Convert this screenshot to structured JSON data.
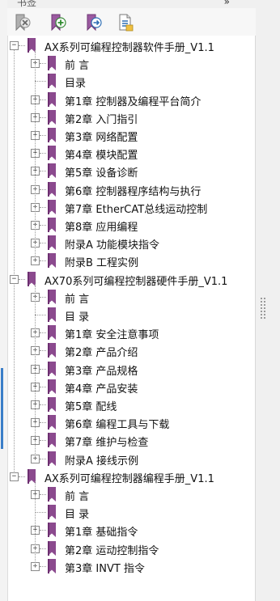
{
  "panel": {
    "title": "书签",
    "collapse_glyph": "»",
    "toolbar": [
      {
        "name": "delete-bookmark",
        "icon": "delete-bookmark-icon"
      },
      {
        "name": "add-bookmark",
        "icon": "add-bookmark-icon"
      },
      {
        "name": "move-bookmark",
        "icon": "move-bookmark-icon"
      },
      {
        "name": "bookmark-properties",
        "icon": "document-properties-icon"
      }
    ]
  },
  "colors": {
    "bookmark": "#8b4a8e",
    "accent": "#3a7ec8",
    "text": "#111111"
  },
  "manuals": [
    {
      "title": "AX系列可编程控制器软件手册_V1.1",
      "expanded": true,
      "chapters": [
        {
          "label": "前 言",
          "expandable": true
        },
        {
          "label": "目录",
          "expandable": false
        },
        {
          "label": "第1章 控制器及编程平台简介",
          "expandable": true
        },
        {
          "label": "第2章 入门指引",
          "expandable": true
        },
        {
          "label": "第3章 网络配置",
          "expandable": true
        },
        {
          "label": "第4章 模块配置",
          "expandable": true
        },
        {
          "label": "第5章 设备诊断",
          "expandable": true
        },
        {
          "label": "第6章 控制器程序结构与执行",
          "expandable": true
        },
        {
          "label": "第7章 EtherCAT总线运动控制",
          "expandable": true
        },
        {
          "label": "第8章 应用编程",
          "expandable": true
        },
        {
          "label": "附录A 功能模块指令",
          "expandable": true
        },
        {
          "label": "附录B 工程实例",
          "expandable": true
        }
      ]
    },
    {
      "title": "AX70系列可编程控制器硬件手册_V1.1",
      "expanded": true,
      "chapters": [
        {
          "label": "前 言",
          "expandable": true
        },
        {
          "label": "目 录",
          "expandable": false
        },
        {
          "label": "第1章 安全注意事项",
          "expandable": true
        },
        {
          "label": "第2章 产品介绍",
          "expandable": true
        },
        {
          "label": "第3章 产品规格",
          "expandable": true
        },
        {
          "label": "第4章 产品安装",
          "expandable": true
        },
        {
          "label": "第5章 配线",
          "expandable": true
        },
        {
          "label": "第6章 编程工具与下载",
          "expandable": true
        },
        {
          "label": "第7章 维护与检查",
          "expandable": true
        },
        {
          "label": "附录A 接线示例",
          "expandable": true
        }
      ]
    },
    {
      "title": "AX系列可编程控制器编程手册_V1.1",
      "expanded": true,
      "chapters": [
        {
          "label": "前 言",
          "expandable": true
        },
        {
          "label": "目 录",
          "expandable": false
        },
        {
          "label": "第1章 基础指令",
          "expandable": true
        },
        {
          "label": "第2章 运动控制指令",
          "expandable": true
        },
        {
          "label": "第3章 INVT 指令",
          "expandable": true
        }
      ]
    }
  ]
}
